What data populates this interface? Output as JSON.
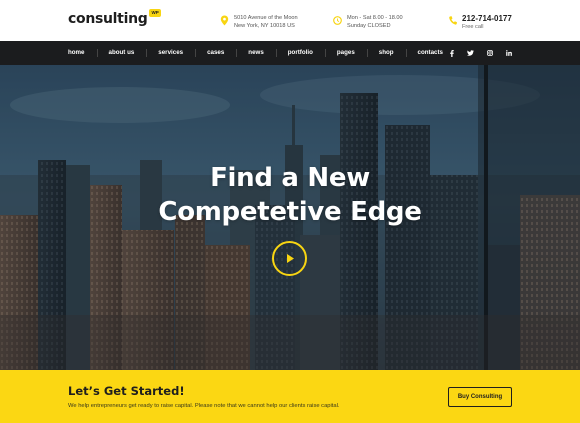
{
  "header": {
    "logo_text": "consulting",
    "logo_badge": "WP",
    "address": {
      "icon": "map-pin-icon",
      "line1": "5010 Avenue of the Moon",
      "line2": "New York, NY 10018 US"
    },
    "hours": {
      "icon": "clock-icon",
      "line1": "Mon - Sat 8.00 - 18.00",
      "line2": "Sunday CLOSED"
    },
    "phone": {
      "icon": "phone-icon",
      "number": "212-714-0177",
      "sub": "Free call"
    }
  },
  "nav": {
    "items": [
      "home",
      "about us",
      "services",
      "cases",
      "news",
      "portfolio",
      "pages",
      "shop",
      "contacts"
    ],
    "social": [
      "facebook-icon",
      "twitter-icon",
      "instagram-icon",
      "linkedin-icon"
    ],
    "social_labels": [
      "f",
      "t",
      "",
      "in"
    ]
  },
  "hero": {
    "title_line1": "Find a New",
    "title_line2": "Competetive Edge",
    "play_icon": "play-icon"
  },
  "cta": {
    "title": "Let’s Get Started!",
    "text": "We help entrepreneurs get ready to raise capital. Please note that we cannot help our clients raise capital.",
    "button_label": "Buy Consulting"
  },
  "colors": {
    "accent": "#fbd713",
    "nav_bg": "#1b1c1e",
    "text_dark": "#1e1e1e"
  }
}
